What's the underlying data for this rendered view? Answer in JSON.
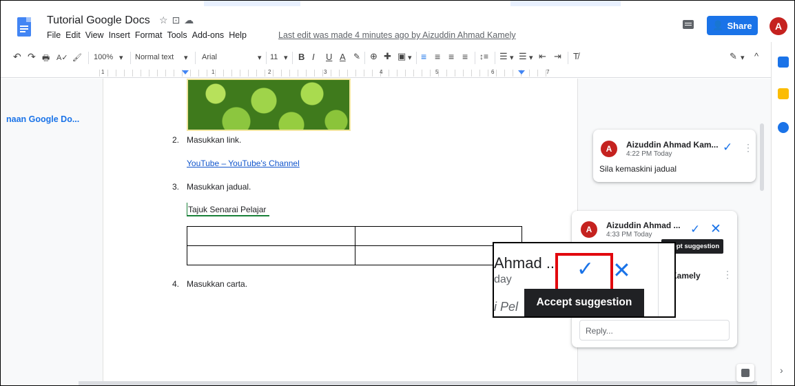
{
  "app": {
    "doc_title": "Tutorial Google Docs",
    "title_icons": [
      "☆",
      "⊡",
      "☁"
    ],
    "menu": [
      "File",
      "Edit",
      "View",
      "Insert",
      "Format",
      "Tools",
      "Add-ons",
      "Help"
    ],
    "last_edit": "Last edit was made 4 minutes ago by Aizuddin Ahmad Kamely",
    "share_label": "Share",
    "user_initial": "A"
  },
  "toolbar": {
    "undo": "↶",
    "redo": "↷",
    "print": "🖶",
    "spellcheck": "A✓",
    "paint_format": "🖌",
    "zoom": "100%",
    "style": "Normal text",
    "font": "Arial",
    "size": "11",
    "bold": "B",
    "italic": "I",
    "underline": "U",
    "text_color": "A",
    "highlight": "✎",
    "link": "⊕",
    "comment": "✚",
    "image": "▣",
    "align": [
      "≡",
      "≡",
      "≡",
      "≡"
    ],
    "line_spacing": "↕≡",
    "checklist": "☰",
    "bullets": "☰",
    "indent_less": "⇤",
    "indent_more": "⇥",
    "clear_format": "T̸",
    "edit_mode": "✎",
    "collapse": "^"
  },
  "ruler": {
    "numbers": [
      "1",
      "1",
      "2",
      "3",
      "4",
      "5",
      "6",
      "7"
    ]
  },
  "outline": {
    "item": "naan Google Do..."
  },
  "document": {
    "item2_num": "2.",
    "item2_text": "Masukkan link.",
    "link_text": "YouTube – YouTube's Channel",
    "item3_num": "3.",
    "item3_text": "Masukkan jadual.",
    "table_title": "Tajuk Senarai Pelajar",
    "item4_num": "4.",
    "item4_text": "Masukkan carta."
  },
  "comments": [
    {
      "initial": "A",
      "author": "Aizuddin Ahmad Kam...",
      "time": "4:22 PM Today",
      "text": "Sila kemaskini jadual"
    },
    {
      "initial": "A",
      "author": "Aizuddin Ahmad ...",
      "time": "4:33 PM Today",
      "tooltip": "ccept suggestion",
      "second_author": "Kamely",
      "reply_placeholder": "Reply..."
    }
  ],
  "zoom_callout": {
    "name": "Ahmad ...",
    "day": "day",
    "snippet": "i Pel",
    "tooltip": "Accept suggestion"
  },
  "icons": {
    "check": "✓",
    "close": "✕",
    "more": "⋮",
    "rail_expand": "›"
  },
  "colors": {
    "accent": "#1a73e8",
    "avatar": "#c5221f",
    "highlight_box": "#e1060d"
  }
}
